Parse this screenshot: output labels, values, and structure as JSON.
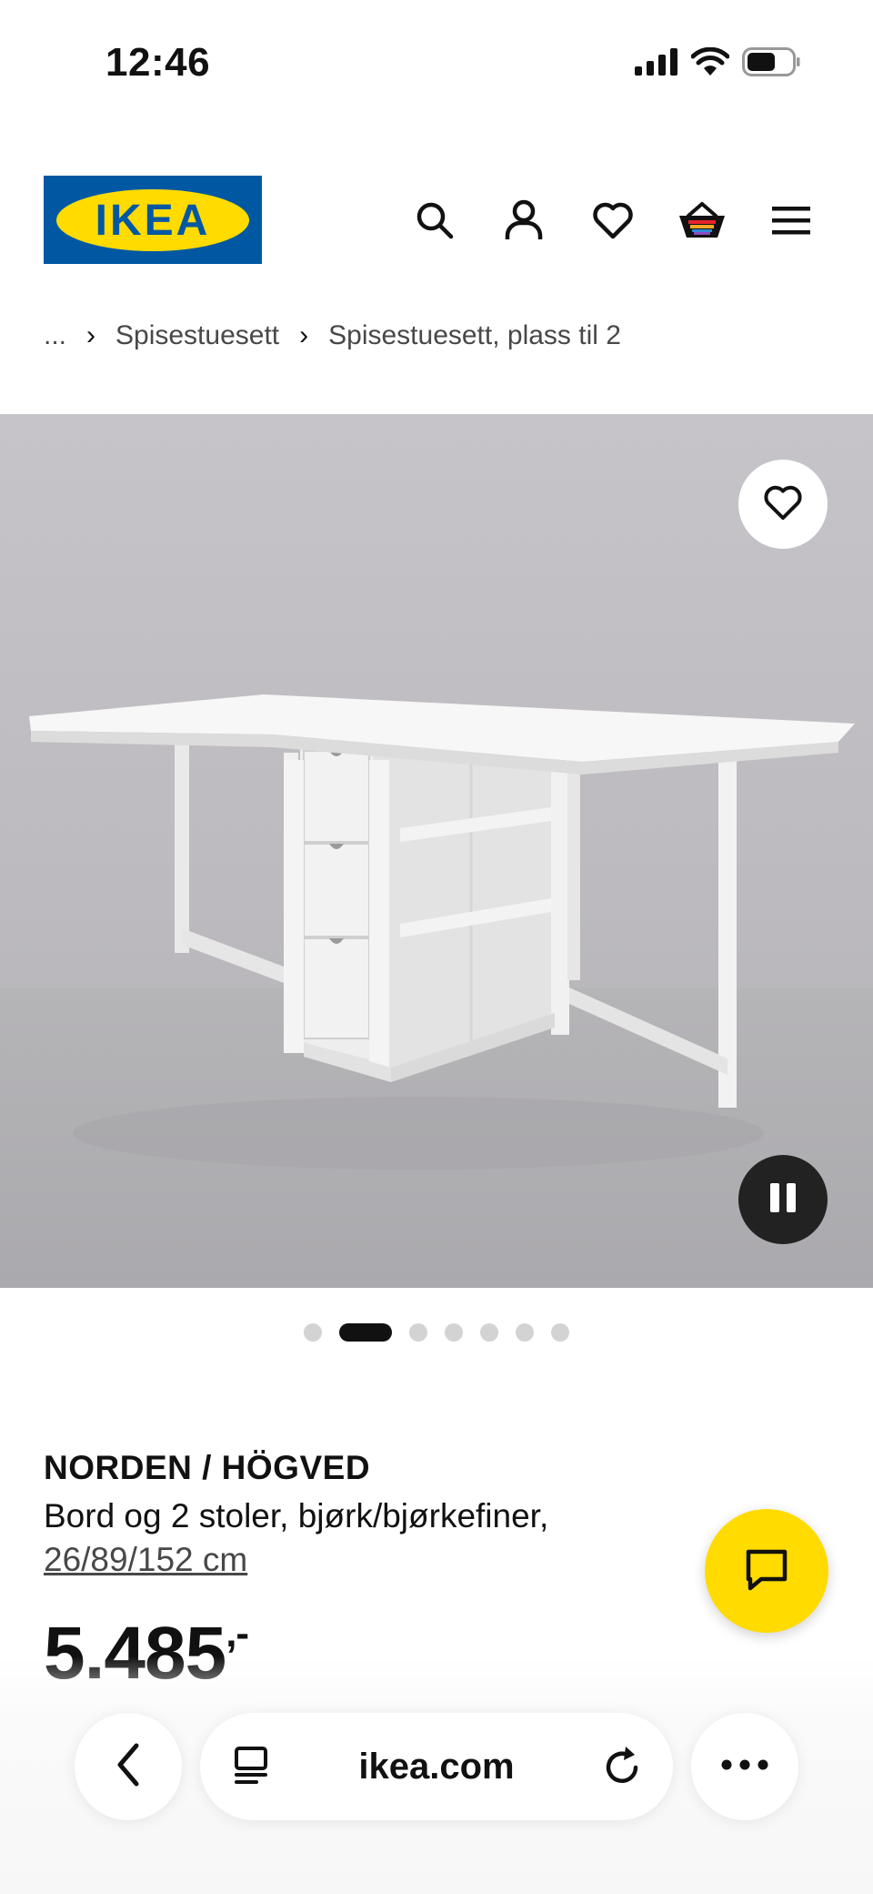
{
  "status_bar": {
    "time": "12:46",
    "icons": [
      "cellular-signal-icon",
      "wifi-icon",
      "battery-icon"
    ]
  },
  "header": {
    "logo_text": "IKEA",
    "brand_colors": {
      "blue": "#0058a3",
      "yellow": "#ffdb00"
    },
    "icons": [
      "search-icon",
      "account-icon",
      "favourites-icon",
      "cart-icon",
      "menu-icon"
    ]
  },
  "breadcrumb": {
    "ellipsis": "...",
    "items": [
      {
        "label": "Spisestuesett"
      },
      {
        "label": "Spisestuesett, plass til 2"
      }
    ]
  },
  "gallery": {
    "slide_count": 7,
    "active_slide": 2,
    "favourite_icon": "heart-icon",
    "pause_icon": "pause-icon"
  },
  "product": {
    "name": "NORDEN / HÖGVED",
    "description": "Bord og 2 stoler, bjørk/bjørkefiner,",
    "dimensions": "26/89/152 cm",
    "price": "5.485",
    "price_suffix": ",-"
  },
  "chat": {
    "icon": "chat-icon"
  },
  "browser_bar": {
    "url": "ikea.com",
    "icons": [
      "back-chevron-icon",
      "reader-icon",
      "reload-icon",
      "more-icon"
    ]
  }
}
